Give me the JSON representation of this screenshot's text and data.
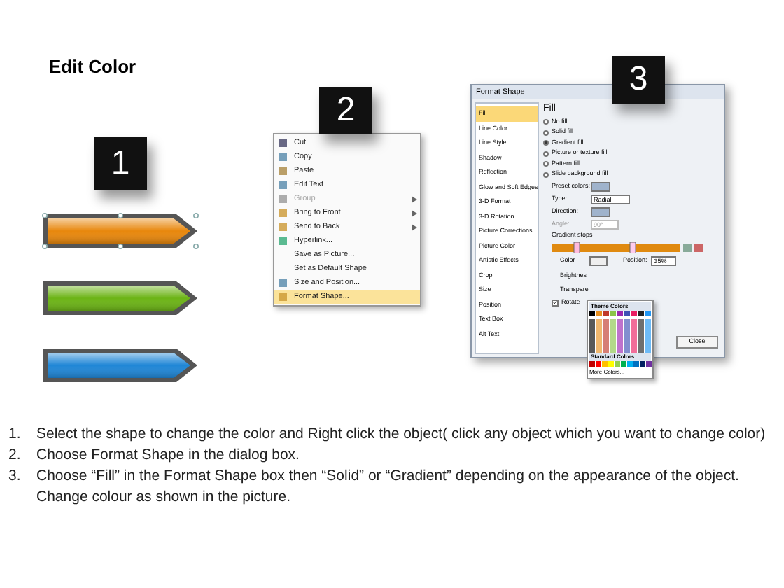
{
  "title": "Edit Color",
  "steps": [
    {
      "number": "1"
    },
    {
      "number": "2"
    },
    {
      "number": "3"
    }
  ],
  "shapes": [
    {
      "color": "#e8870c",
      "selected": true
    },
    {
      "color": "#6cb416",
      "selected": false
    },
    {
      "color": "#1f86d6",
      "selected": false
    }
  ],
  "context_menu": {
    "items": [
      {
        "label": "Cut",
        "disabled": false,
        "submenu": false,
        "selected": false
      },
      {
        "label": "Copy",
        "disabled": false,
        "submenu": false,
        "selected": false
      },
      {
        "label": "Paste",
        "disabled": false,
        "submenu": false,
        "selected": false
      },
      {
        "label": "Edit Text",
        "disabled": false,
        "submenu": false,
        "selected": false
      },
      {
        "label": "Group",
        "disabled": true,
        "submenu": true,
        "selected": false
      },
      {
        "label": "Bring to Front",
        "disabled": false,
        "submenu": true,
        "selected": false
      },
      {
        "label": "Send to Back",
        "disabled": false,
        "submenu": true,
        "selected": false
      },
      {
        "label": "Hyperlink...",
        "disabled": false,
        "submenu": false,
        "selected": false
      },
      {
        "label": "Save as Picture...",
        "disabled": false,
        "submenu": false,
        "selected": false
      },
      {
        "label": "Set as Default Shape",
        "disabled": false,
        "submenu": false,
        "selected": false
      },
      {
        "label": "Size and Position...",
        "disabled": false,
        "submenu": false,
        "selected": false
      },
      {
        "label": "Format Shape...",
        "disabled": false,
        "submenu": false,
        "selected": true
      }
    ]
  },
  "dialog": {
    "title": "Format Shape",
    "sidebar": [
      {
        "label": "Fill",
        "selected": true
      },
      {
        "label": "Line Color",
        "selected": false
      },
      {
        "label": "Line Style",
        "selected": false
      },
      {
        "label": "Shadow",
        "selected": false
      },
      {
        "label": "Reflection",
        "selected": false
      },
      {
        "label": "Glow and Soft Edges",
        "selected": false
      },
      {
        "label": "3-D Format",
        "selected": false
      },
      {
        "label": "3-D Rotation",
        "selected": false
      },
      {
        "label": "Picture Corrections",
        "selected": false
      },
      {
        "label": "Picture Color",
        "selected": false
      },
      {
        "label": "Artistic Effects",
        "selected": false
      },
      {
        "label": "Crop",
        "selected": false
      },
      {
        "label": "Size",
        "selected": false
      },
      {
        "label": "Position",
        "selected": false
      },
      {
        "label": "Text Box",
        "selected": false
      },
      {
        "label": "Alt Text",
        "selected": false
      }
    ],
    "heading": "Fill",
    "fill_options": [
      {
        "label": "No fill",
        "selected": false
      },
      {
        "label": "Solid fill",
        "selected": false
      },
      {
        "label": "Gradient fill",
        "selected": true
      },
      {
        "label": "Picture or texture fill",
        "selected": false
      },
      {
        "label": "Pattern fill",
        "selected": false
      },
      {
        "label": "Slide background fill",
        "selected": false
      }
    ],
    "preset_label": "Preset colors:",
    "type_label": "Type:",
    "type_value": "Radial",
    "direction_label": "Direction:",
    "angle_label": "Angle:",
    "angle_value": "90°",
    "stops_label": "Gradient stops",
    "color_label": "Color",
    "position_label": "Position:",
    "position_value": "35%",
    "brightness_label": "Brightnes",
    "transparency_label": "Transpare",
    "rotate_label": "Rotate",
    "rotate_checked": true,
    "close_button": "Close",
    "color_popup": {
      "theme_heading": "Theme Colors",
      "standard_heading": "Standard Colors",
      "more_link": "More Colors..."
    }
  },
  "instructions": [
    {
      "number": "1.",
      "text": "Select the shape to change the color and Right click the object( click any object which you want to change color)"
    },
    {
      "number": "2.",
      "text": "Choose Format Shape in the dialog box."
    },
    {
      "number": "3.",
      "text": "Choose “Fill” in the Format Shape box then “Solid” or “Gradient” depending on the appearance of the object. Change colour as shown in the picture."
    }
  ]
}
